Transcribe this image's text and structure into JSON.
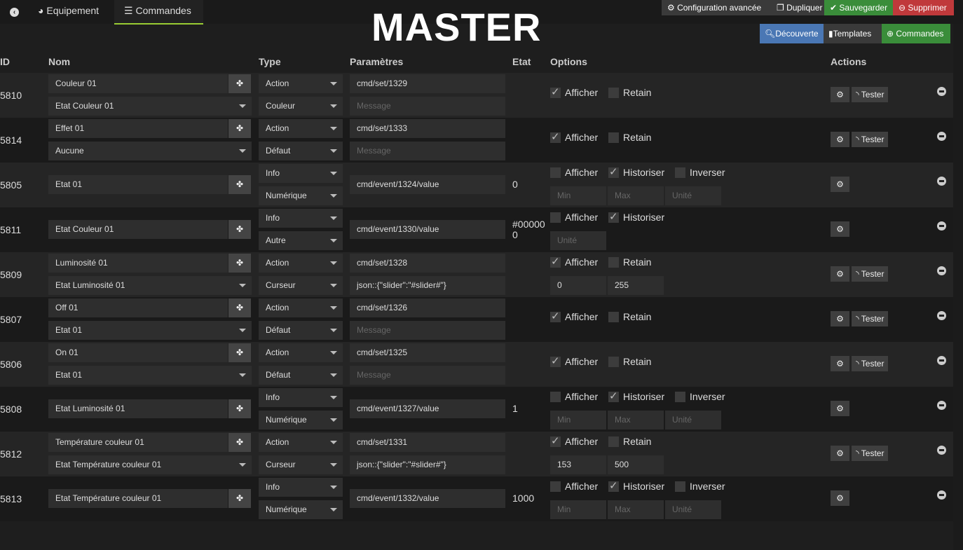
{
  "tabs": {
    "back": "",
    "equipement": "Equipement",
    "commandes": "Commandes"
  },
  "title": "MASTER",
  "toolbar": {
    "config": "Configuration avancée",
    "dupliquer": "Dupliquer",
    "sauvegarder": "Sauvegarder",
    "supprimer": "Supprimer"
  },
  "subtoolbar": {
    "decouverte": "Découverte",
    "templates": "Templates",
    "commandes": "Commandes"
  },
  "headers": {
    "id": "ID",
    "nom": "Nom",
    "type": "Type",
    "params": "Paramètres",
    "etat": "Etat",
    "options": "Options",
    "actions": "Actions"
  },
  "labels": {
    "afficher": "Afficher",
    "retain": "Retain",
    "historiser": "Historiser",
    "inverser": "Inverser",
    "tester": "Tester",
    "min": "Min",
    "max": "Max",
    "unite": "Unité",
    "message": "Message"
  },
  "rows": [
    {
      "id": "5810",
      "name": "Couleur 01",
      "value": "Etat Couleur 01",
      "type": "Action",
      "subtype": "Couleur",
      "param": "cmd/set/1329",
      "param2": "",
      "etat": "",
      "afficher": true,
      "retain": false
    },
    {
      "id": "5814",
      "name": "Effet 01",
      "value": "Aucune",
      "type": "Action",
      "subtype": "Défaut",
      "param": "cmd/set/1333",
      "param2": "",
      "etat": "",
      "afficher": true,
      "retain": false
    },
    {
      "id": "5805",
      "name": "Etat 01",
      "type": "Info",
      "subtype": "Numérique",
      "param": "cmd/event/1324/value",
      "etat": "0",
      "afficher": false,
      "historiser": true,
      "inverser": false,
      "minmax": true
    },
    {
      "id": "5811",
      "name": "Etat Couleur 01",
      "type": "Info",
      "subtype": "Autre",
      "param": "cmd/event/1330/value",
      "etat": "#000000",
      "afficher": false,
      "historiser": true,
      "minmax": false
    },
    {
      "id": "5809",
      "name": "Luminosité 01",
      "value": "Etat Luminosité 01",
      "type": "Action",
      "subtype": "Curseur",
      "param": "cmd/set/1328",
      "param2": "json::{\"slider\":\"#slider#\"}",
      "etat": "",
      "afficher": true,
      "retain": false,
      "min": "0",
      "max": "255"
    },
    {
      "id": "5807",
      "name": "Off 01",
      "value": "Etat 01",
      "type": "Action",
      "subtype": "Défaut",
      "param": "cmd/set/1326",
      "param2": "",
      "etat": "",
      "afficher": true,
      "retain": false
    },
    {
      "id": "5806",
      "name": "On 01",
      "value": "Etat 01",
      "type": "Action",
      "subtype": "Défaut",
      "param": "cmd/set/1325",
      "param2": "",
      "etat": "",
      "afficher": true,
      "retain": false
    },
    {
      "id": "5808",
      "name": "Etat Luminosité 01",
      "type": "Info",
      "subtype": "Numérique",
      "param": "cmd/event/1327/value",
      "etat": "1",
      "afficher": false,
      "historiser": true,
      "inverser": false,
      "minmax": true
    },
    {
      "id": "5812",
      "name": "Température couleur 01",
      "value": "Etat Température couleur 01",
      "type": "Action",
      "subtype": "Curseur",
      "param": "cmd/set/1331",
      "param2": "json::{\"slider\":\"#slider#\"}",
      "etat": "",
      "afficher": true,
      "retain": false,
      "min": "153",
      "max": "500"
    },
    {
      "id": "5813",
      "name": "Etat Température couleur 01",
      "type": "Info",
      "subtype": "Numérique",
      "param": "cmd/event/1332/value",
      "etat": "1000",
      "afficher": false,
      "historiser": true,
      "inverser": false,
      "minmax": true
    }
  ]
}
